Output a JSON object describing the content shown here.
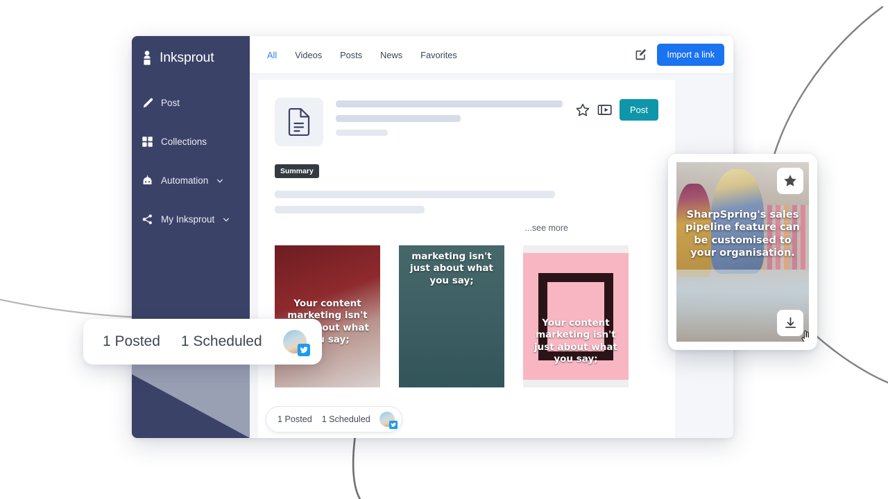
{
  "app": {
    "brand_name": "Inksprout",
    "brand_icon": "inksprout-logo-icon"
  },
  "sidebar": {
    "items": [
      {
        "label": "Post",
        "icon": "pencil-icon",
        "caret": false
      },
      {
        "label": "Collections",
        "icon": "grid-icon",
        "caret": false
      },
      {
        "label": "Automation",
        "icon": "robot-icon",
        "caret": true
      },
      {
        "label": "My Inksprout",
        "icon": "share-icon",
        "caret": true
      }
    ]
  },
  "topbar": {
    "tabs": [
      {
        "label": "All",
        "active": true
      },
      {
        "label": "Videos",
        "active": false
      },
      {
        "label": "Posts",
        "active": false
      },
      {
        "label": "News",
        "active": false
      },
      {
        "label": "Favorites",
        "active": false
      }
    ],
    "compose_icon": "compose-pencil-square-icon",
    "import_label": "Import a link"
  },
  "content_card": {
    "doc_icon": "document-text-icon",
    "star_icon": "star-outline-icon",
    "video_icon": "video-stack-icon",
    "post_label": "Post",
    "summary_tag": "Summary",
    "see_more": "...see more"
  },
  "thumbnails": [
    {
      "caption": "Your content marketing isn't just about what you say;",
      "name": "thumbnail-red-curtain"
    },
    {
      "caption": "marketing isn't just about what you say;",
      "name": "thumbnail-teal-room"
    },
    {
      "caption": "Your content marketing isn't just about what you say;",
      "name": "thumbnail-pink-frame"
    }
  ],
  "status_pill": {
    "posted": "1 Posted",
    "scheduled": "1 Scheduled",
    "network_icon": "twitter-icon",
    "avatar": "user-avatar"
  },
  "float_card": {
    "caption": "SharpSpring's sales pipeline feature can be customised to your organisation.",
    "star_icon": "star-filled-icon",
    "download_icon": "download-icon",
    "cursor_icon": "pointer-hand-cursor-icon"
  },
  "colors": {
    "sidebar_navy": "#3b4268",
    "sidebar_gray": "#9aa0b4",
    "import_blue": "#1a73f0",
    "post_teal": "#1096ab",
    "tab_active_blue": "#2f80f7",
    "twitter_blue": "#1d9bf0",
    "summary_dark": "#343a40"
  }
}
